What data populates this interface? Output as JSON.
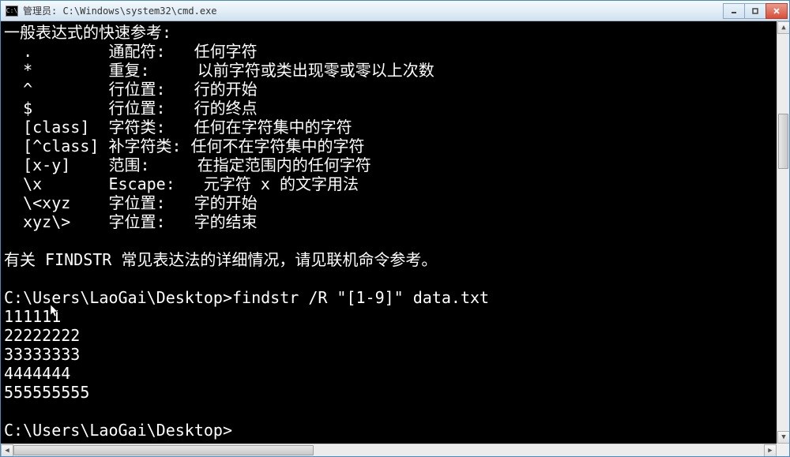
{
  "window": {
    "title": "管理员: C:\\Windows\\system32\\cmd.exe"
  },
  "terminal": {
    "help": {
      "header": "一般表达式的快速参考:",
      "rows": [
        {
          "sym": ".",
          "label": "通配符:",
          "desc": "任何字符"
        },
        {
          "sym": "*",
          "label": "重复:",
          "desc": "以前字符或类出现零或零以上次数"
        },
        {
          "sym": "^",
          "label": "行位置:",
          "desc": "行的开始"
        },
        {
          "sym": "$",
          "label": "行位置:",
          "desc": "行的终点"
        },
        {
          "sym": "[class]",
          "label": "字符类:",
          "desc": "任何在字符集中的字符"
        },
        {
          "sym": "[^class]",
          "label": "补字符类:",
          "desc": "任何不在字符集中的字符"
        },
        {
          "sym": "[x-y]",
          "label": "范围:",
          "desc": "在指定范围内的任何字符"
        },
        {
          "sym": "\\x",
          "label": "Escape:",
          "desc": "元字符 x 的文字用法"
        },
        {
          "sym": "\\<xyz",
          "label": "字位置:",
          "desc": "字的开始"
        },
        {
          "sym": "xyz\\>",
          "label": "字位置:",
          "desc": "字的结束"
        }
      ],
      "footer": "有关 FINDSTR 常见表达法的详细情况，请见联机命令参考。"
    },
    "prompt1": "C:\\Users\\LaoGai\\Desktop>",
    "command1": "findstr /R \"[1-9]\" data.txt",
    "output": [
      "111111",
      "22222222",
      "33333333",
      "4444444",
      "555555555"
    ],
    "prompt2": "C:\\Users\\LaoGai\\Desktop>"
  }
}
